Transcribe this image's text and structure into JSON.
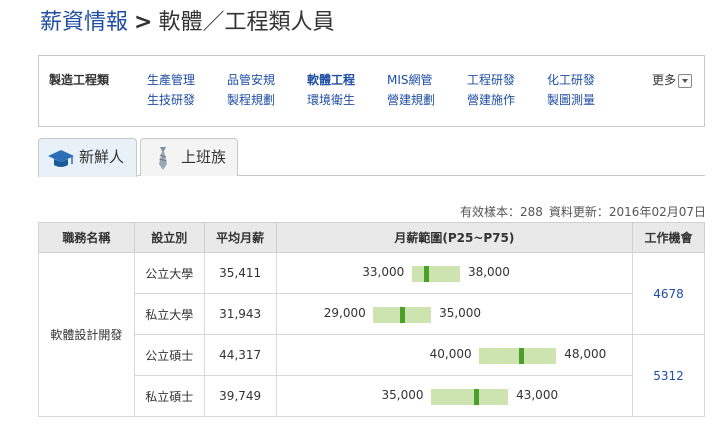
{
  "page": {
    "title_link": "薪資情報",
    "title_sep": ">",
    "title_current": "軟體／工程類人員"
  },
  "categories": {
    "label": "製造工程類",
    "more": "更多",
    "items": [
      {
        "label": "生產管理",
        "active": false
      },
      {
        "label": "品管安規",
        "active": false
      },
      {
        "label": "軟體工程",
        "active": true
      },
      {
        "label": "MIS網管",
        "active": false
      },
      {
        "label": "工程研發",
        "active": false
      },
      {
        "label": "化工研發",
        "active": false
      },
      {
        "label": "生技研發",
        "active": false
      },
      {
        "label": "製程規劃",
        "active": false
      },
      {
        "label": "環境衛生",
        "active": false
      },
      {
        "label": "營建規劃",
        "active": false
      },
      {
        "label": "營建施作",
        "active": false
      },
      {
        "label": "製圖測量",
        "active": false
      }
    ]
  },
  "tabs": {
    "fresh": "新鮮人",
    "worker": "上班族"
  },
  "meta": {
    "sample": "有效樣本：288",
    "updated": "資料更新：2016年02月07日"
  },
  "table": {
    "headers": {
      "job": "職務名稱",
      "school": "設立別",
      "avg": "平均月薪",
      "range": "月薪範圍(P25~P75)",
      "opp": "工作機會"
    },
    "job": "軟體設計開發",
    "scale": [
      20000,
      55000
    ],
    "rows": [
      {
        "school": "公立大學",
        "avg": "35,411",
        "low": 33000,
        "high": 38000,
        "low_label": "33,000",
        "high_label": "38,000",
        "median": 34500
      },
      {
        "school": "私立大學",
        "avg": "31,943",
        "low": 29000,
        "high": 35000,
        "low_label": "29,000",
        "high_label": "35,000",
        "median": 32000
      },
      {
        "school": "公立碩士",
        "avg": "44,317",
        "low": 40000,
        "high": 48000,
        "low_label": "40,000",
        "high_label": "48,000",
        "median": 44300
      },
      {
        "school": "私立碩士",
        "avg": "39,749",
        "low": 35000,
        "high": 43000,
        "low_label": "35,000",
        "high_label": "43,000",
        "median": 39700
      }
    ],
    "opportunities": [
      "4678",
      "5312"
    ]
  }
}
